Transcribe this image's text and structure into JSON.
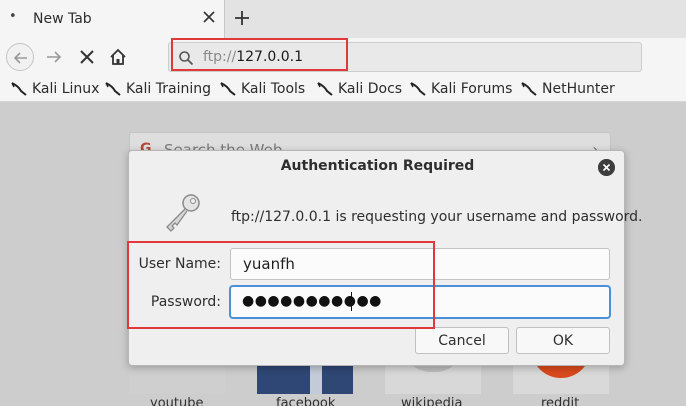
{
  "tab": {
    "title": "New Tab"
  },
  "toolbar": {
    "url_scheme": "ftp://",
    "url_host": "127.0.0.1"
  },
  "bookmarks": [
    {
      "label": "Kali Linux"
    },
    {
      "label": "Kali Training"
    },
    {
      "label": "Kali Tools"
    },
    {
      "label": "Kali Docs"
    },
    {
      "label": "Kali Forums"
    },
    {
      "label": "NetHunter"
    }
  ],
  "page": {
    "search_placeholder": "Search the Web",
    "tiles": [
      {
        "label": "youtube"
      },
      {
        "label": "facebook"
      },
      {
        "label": "wikipedia"
      },
      {
        "label": "reddit"
      }
    ]
  },
  "dialog": {
    "title": "Authentication Required",
    "message": "ftp://127.0.0.1 is requesting your username and password.",
    "username_label": "User Name:",
    "username_value": "yuanfh",
    "password_label": "Password:",
    "password_mask": "●●●●●●●●●●●",
    "cancel_label": "Cancel",
    "ok_label": "OK"
  },
  "colors": {
    "highlight": "#e0383b",
    "focus": "#4a90d9"
  }
}
